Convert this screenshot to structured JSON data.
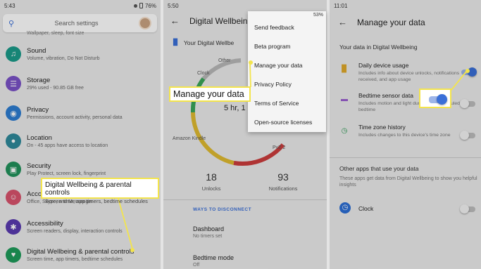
{
  "panel1": {
    "status": {
      "time": "5:43",
      "battery": "76%"
    },
    "search_placeholder": "Search settings",
    "clipped_text": "Wallpaper, sleep, font size",
    "rows": [
      {
        "title": "Sound",
        "subtitle": "Volume, vibration, Do Not Disturb",
        "icon": "volume-icon",
        "color": "#1a9b8a"
      },
      {
        "title": "Storage",
        "subtitle": "29% used - 90.85 GB free",
        "icon": "storage-icon",
        "color": "#7b52c8"
      },
      {
        "title": "Privacy",
        "subtitle": "Permissions, account activity, personal data",
        "icon": "privacy-eye-icon",
        "color": "#2d7dd2"
      },
      {
        "title": "Location",
        "subtitle": "On - 45 apps have access to location",
        "icon": "location-pin-icon",
        "color": "#2f8a9b"
      },
      {
        "title": "Security",
        "subtitle": "Play Protect, screen lock, fingerprint",
        "icon": "lock-icon",
        "color": "#21925b"
      },
      {
        "title": "Acco",
        "subtitle": "Office, Skype, and Messenger",
        "icon": "accounts-icon",
        "color": "#d9536d"
      },
      {
        "title": "Accessibility",
        "subtitle": "Screen readers, display, interaction controls",
        "icon": "accessibility-icon",
        "color": "#5a3bb0"
      },
      {
        "title": "Digital Wellbeing & parental controls",
        "subtitle": "Screen time, app timers, bedtime schedules",
        "icon": "wellbeing-heart-icon",
        "color": "#1e9b5a"
      }
    ],
    "callout": {
      "title": "Digital Wellbeing & parental controls",
      "subtitle": "Screen time, app timers, bedtime schedules"
    }
  },
  "panel2": {
    "status": {
      "time": "5:50"
    },
    "title": "Digital Wellbein",
    "dashboard_label": "Your Digital Wellbe",
    "chart_labels": {
      "other": "Other",
      "clock": "Clock",
      "kindle": "Amazon Kindle",
      "pvz": "PvZ 2"
    },
    "center_time": "5 hr, 1",
    "unlocks": {
      "value": "18",
      "label": "Unlocks"
    },
    "notifications": {
      "value": "93",
      "label": "Notifications"
    },
    "ways_header": "WAYS TO DISCONNECT",
    "items": [
      {
        "title": "Dashboard",
        "subtitle": "No timers set"
      },
      {
        "title": "Bedtime mode",
        "subtitle": "Off"
      }
    ],
    "menu": [
      "Send feedback",
      "Beta program",
      "Manage your data",
      "Privacy Policy",
      "Terms of Service",
      "Open-source licenses"
    ],
    "callout": "Manage your data",
    "status_right": "53%"
  },
  "panel3": {
    "status": {
      "time": "11:01"
    },
    "title": "Manage your data",
    "section1": "Your data in Digital Wellbeing",
    "rows": [
      {
        "title": "Daily device usage",
        "subtitle": "Includes info about device unlocks, notifications received, and app usage",
        "icon": "bar-chart-icon",
        "on": true
      },
      {
        "title": "Bedtime sensor data",
        "subtitle": "Includes motion and light during your scheduled bedtime",
        "icon": "bed-icon",
        "on": false
      },
      {
        "title": "Time zone history",
        "subtitle": "Includes changes to this device's time zone",
        "icon": "clock-icon",
        "on": false
      }
    ],
    "section2": "Other apps that use your data",
    "section2_desc": "These apps get data from Digital Wellbeing to show you helpful insights",
    "clock_row": "Clock"
  }
}
